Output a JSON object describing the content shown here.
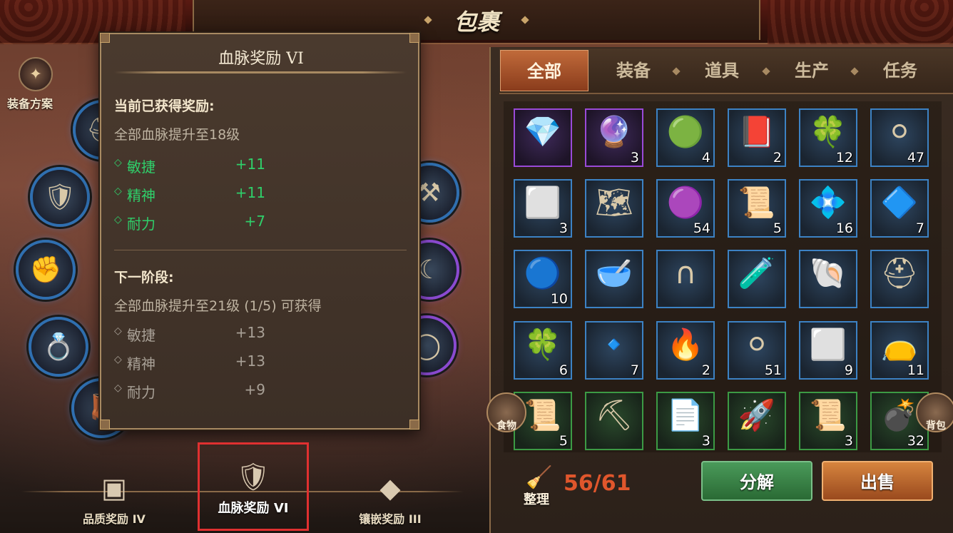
{
  "header": {
    "title": "包裹"
  },
  "equipment": {
    "plan_label": "装备方案",
    "slots": [
      {
        "icon": "helmet-icon"
      },
      {
        "icon": "armor-icon"
      },
      {
        "icon": "gauntlet-icon"
      },
      {
        "icon": "ring-icon"
      },
      {
        "icon": "boots-icon"
      },
      {
        "icon": "totem-icon"
      },
      {
        "icon": "fang-necklace-icon"
      },
      {
        "icon": "gold-ring-icon"
      }
    ]
  },
  "tooltip": {
    "title": "血脉奖励 VI",
    "current_heading": "当前已获得奖励:",
    "current_desc": "全部血脉提升至18级",
    "current_stats": [
      {
        "name": "敏捷",
        "value": "+11"
      },
      {
        "name": "精神",
        "value": "+11"
      },
      {
        "name": "耐力",
        "value": "+7"
      }
    ],
    "next_heading": "下一阶段:",
    "next_desc": "全部血脉提升至21级 (1/5) 可获得",
    "next_stats": [
      {
        "name": "敏捷",
        "value": "+13"
      },
      {
        "name": "精神",
        "value": "+13"
      },
      {
        "name": "耐力",
        "value": "+9"
      }
    ]
  },
  "rewards": [
    {
      "label": "品质奖励 IV",
      "icon": "book-icon",
      "selected": false
    },
    {
      "label": "血脉奖励 VI",
      "icon": "chestplate-icon",
      "selected": true
    },
    {
      "label": "镶嵌奖励 III",
      "icon": "gem-cluster-icon",
      "selected": false
    }
  ],
  "bag": {
    "tabs": [
      "全部",
      "装备",
      "道具",
      "生产",
      "任务"
    ],
    "active_tab": "全部",
    "side_left_label": "食物",
    "side_right_label": "背包",
    "items": [
      {
        "icon": "blue-crystal-icon",
        "qty": "",
        "rarity": "purple"
      },
      {
        "icon": "purple-gem-icon",
        "qty": "3",
        "rarity": "purple"
      },
      {
        "icon": "green-crystal-icon",
        "qty": "4",
        "rarity": "blue"
      },
      {
        "icon": "red-book-icon",
        "qty": "2",
        "rarity": "blue"
      },
      {
        "icon": "green-ore-icon",
        "qty": "12",
        "rarity": "blue"
      },
      {
        "icon": "silver-orb-icon",
        "qty": "47",
        "rarity": "blue"
      },
      {
        "icon": "silver-ore-icon",
        "qty": "3",
        "rarity": "blue"
      },
      {
        "icon": "map-scroll-icon",
        "qty": "",
        "rarity": "blue"
      },
      {
        "icon": "amethyst-icon",
        "qty": "54",
        "rarity": "blue"
      },
      {
        "icon": "scroll-icon",
        "qty": "5",
        "rarity": "blue"
      },
      {
        "icon": "cyan-crystal-icon",
        "qty": "16",
        "rarity": "blue"
      },
      {
        "icon": "blue-shard-icon",
        "qty": "7",
        "rarity": "blue"
      },
      {
        "icon": "blue-pearl-icon",
        "qty": "10",
        "rarity": "blue"
      },
      {
        "icon": "flour-bowl-icon",
        "qty": "",
        "rarity": "blue"
      },
      {
        "icon": "horseshoe-icon",
        "qty": "",
        "rarity": "blue"
      },
      {
        "icon": "potion-icon",
        "qty": "",
        "rarity": "blue"
      },
      {
        "icon": "shell-icon",
        "qty": "",
        "rarity": "blue"
      },
      {
        "icon": "helmet-item-icon",
        "qty": "",
        "rarity": "blue"
      },
      {
        "icon": "green-ore-icon",
        "qty": "6",
        "rarity": "blue"
      },
      {
        "icon": "blue-orb-icon",
        "qty": "7",
        "rarity": "blue"
      },
      {
        "icon": "ember-icon",
        "qty": "2",
        "rarity": "blue"
      },
      {
        "icon": "silver-orb-icon",
        "qty": "51",
        "rarity": "blue"
      },
      {
        "icon": "silver-ore-icon",
        "qty": "9",
        "rarity": "blue"
      },
      {
        "icon": "leather-bag-icon",
        "qty": "11",
        "rarity": "blue"
      },
      {
        "icon": "scroll-icon",
        "qty": "5",
        "rarity": "green"
      },
      {
        "icon": "shovel-icon",
        "qty": "",
        "rarity": "green"
      },
      {
        "icon": "paper-icon",
        "qty": "3",
        "rarity": "green"
      },
      {
        "icon": "rocket-icon",
        "qty": "",
        "rarity": "green"
      },
      {
        "icon": "scroll-icon",
        "qty": "3",
        "rarity": "green"
      },
      {
        "icon": "grenade-icon",
        "qty": "32",
        "rarity": "green"
      }
    ],
    "sort_label": "整理",
    "capacity": "56/61",
    "decompose_label": "分解",
    "sell_label": "出售"
  }
}
